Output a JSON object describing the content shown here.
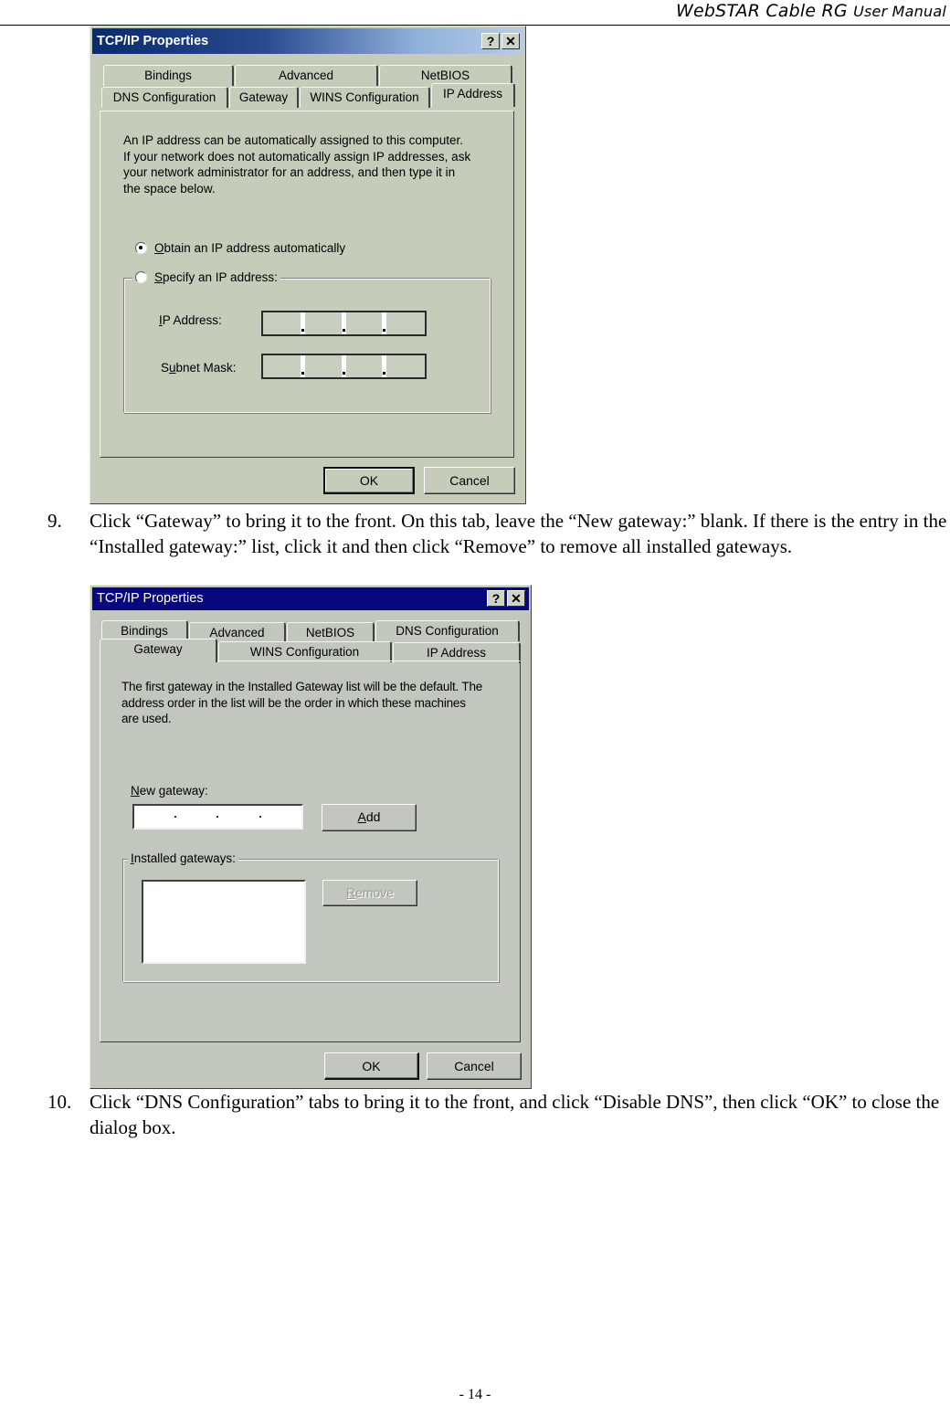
{
  "header": {
    "title_main": "WebSTAR Cable RG",
    "title_sub": "User Manual"
  },
  "footer": {
    "page_number": "- 14 -"
  },
  "dialog1": {
    "title": "TCP/IP Properties",
    "help_glyph": "?",
    "close_glyph": "✕",
    "tabs_back": [
      "Bindings",
      "Advanced",
      "NetBIOS"
    ],
    "tabs_front": [
      "DNS Configuration",
      "Gateway",
      "WINS Configuration",
      "IP Address"
    ],
    "active_tab": "IP Address",
    "description": [
      "An IP address can be automatically assigned to this computer.",
      "If your network does not automatically assign IP addresses, ask",
      "your network administrator for an address, and then type it in",
      "the space below."
    ],
    "radio_obtain": {
      "access_key": "O",
      "rest": "btain an IP address automatically",
      "checked": true
    },
    "radio_specify": {
      "access_key": "S",
      "rest": "pecify an IP address:",
      "checked": false
    },
    "ip_address_label": {
      "pre": "",
      "access_key": "I",
      "rest": "P Address:"
    },
    "subnet_mask_label": {
      "pre": "S",
      "access_key": "u",
      "rest": "bnet Mask:"
    },
    "ip_address_value": "",
    "subnet_mask_value": "",
    "ok_label": "OK",
    "cancel_label": "Cancel"
  },
  "step9": {
    "number": "9.",
    "text": "Click “Gateway” to bring it to the front. On this tab, leave the “New gateway:” blank. If there is the entry in the “Installed gateway:” list, click it and then click “Remove” to remove all installed gateways."
  },
  "dialog2": {
    "title": "TCP/IP Properties",
    "help_glyph": "?",
    "close_glyph": "✕",
    "tabs_back": [
      "Bindings",
      "Advanced",
      "NetBIOS",
      "DNS Configuration"
    ],
    "tabs_front": [
      "Gateway",
      "WINS Configuration",
      "IP Address"
    ],
    "active_tab": "Gateway",
    "description": [
      "The first gateway in the Installed Gateway list will be the default. The",
      "address order in the list will be the order in which these machines",
      "are used."
    ],
    "new_gateway_label": {
      "access_key": "N",
      "rest": "ew gateway:"
    },
    "new_gateway_value": "",
    "add_label": {
      "access_key": "A",
      "rest": "dd"
    },
    "installed_gateways_label": {
      "access_key": "I",
      "rest": "nstalled gateways:"
    },
    "installed_gateways": [],
    "remove_label": {
      "access_key": "R",
      "rest": "emove"
    },
    "remove_enabled": false,
    "ok_label": "OK",
    "cancel_label": "Cancel"
  },
  "step10": {
    "number": "10.",
    "text": "Click “DNS Configuration” tabs to bring it to the front, and click “Disable DNS”, then click “OK” to close the dialog box."
  }
}
